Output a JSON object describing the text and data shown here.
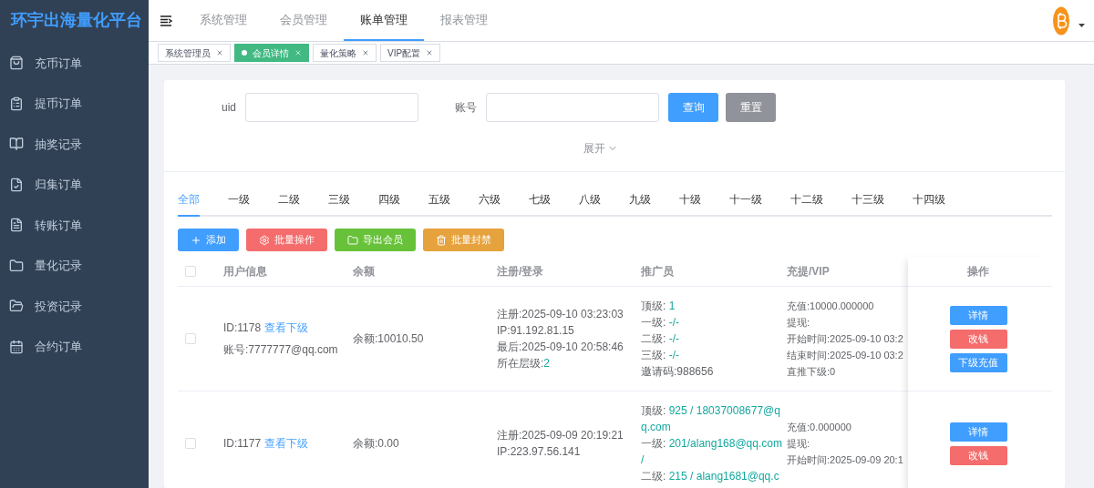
{
  "sidebar": {
    "title": "环宇出海量化平台",
    "items": [
      {
        "label": "充币订单",
        "kind": "bag"
      },
      {
        "label": "提币订单",
        "kind": "clipboard"
      },
      {
        "label": "抽奖记录",
        "kind": "book"
      },
      {
        "label": "归集订单",
        "kind": "doc-check"
      },
      {
        "label": "转账订单",
        "kind": "doc"
      },
      {
        "label": "量化记录",
        "kind": "folder"
      },
      {
        "label": "投资记录",
        "kind": "folder-open"
      },
      {
        "label": "合约订单",
        "kind": "calendar"
      }
    ]
  },
  "header": {
    "nav": [
      {
        "label": "系统管理",
        "selected": false
      },
      {
        "label": "会员管理",
        "selected": false
      },
      {
        "label": "账单管理",
        "selected": true
      },
      {
        "label": "报表管理",
        "selected": false
      }
    ]
  },
  "tags": [
    {
      "label": "系统管理员",
      "selected": false
    },
    {
      "label": "会员详情",
      "selected": true
    },
    {
      "label": "量化策略",
      "selected": false
    },
    {
      "label": "VIP配置",
      "selected": false
    }
  ],
  "search": {
    "fields": [
      {
        "label": "uid"
      },
      {
        "label": "账号"
      }
    ],
    "buttons": [
      {
        "label": "查询",
        "kind": "primary"
      },
      {
        "label": "重置",
        "kind": "secondary"
      }
    ],
    "expand": "展开"
  },
  "level_tabs": [
    {
      "label": "全部",
      "selected": true
    },
    {
      "label": "一级",
      "selected": false
    },
    {
      "label": "二级",
      "selected": false
    },
    {
      "label": "三级",
      "selected": false
    },
    {
      "label": "四级",
      "selected": false
    },
    {
      "label": "五级",
      "selected": false
    },
    {
      "label": "六级",
      "selected": false
    },
    {
      "label": "七级",
      "selected": false
    },
    {
      "label": "八级",
      "selected": false
    },
    {
      "label": "九级",
      "selected": false
    },
    {
      "label": "十级",
      "selected": false
    },
    {
      "label": "十一级",
      "selected": false
    },
    {
      "label": "十二级",
      "selected": false
    },
    {
      "label": "十三级",
      "selected": false
    },
    {
      "label": "十四级",
      "selected": false
    }
  ],
  "actions": [
    {
      "label": "添加",
      "kind": "add",
      "color": "#409eff"
    },
    {
      "label": "批量操作",
      "kind": "batch",
      "color": "#f56c6c"
    },
    {
      "label": "导出会员",
      "kind": "export",
      "color": "#67c23a"
    },
    {
      "label": "批量封禁",
      "kind": "ban",
      "color": "#e6a23c"
    }
  ],
  "table": {
    "select_all": {
      "checked": false
    },
    "columns": [
      "用户信息",
      "余额",
      "注册/登录",
      "推广员",
      "充提/VIP",
      "操作"
    ],
    "rows": [
      {
        "checked": false,
        "id": "ID:1178",
        "link": "查看下级",
        "account": "账号:7777777@qq.com",
        "balance": "余额:10010.50",
        "register": [
          {
            "text": "注册:2025-09-10 03:23:03"
          },
          {
            "text": "IP:91.192.81.15"
          },
          {
            "text": "最后:2025-09-10 20:58:46"
          },
          {
            "text": "所在层级:",
            "value": "2"
          }
        ],
        "promoter": [
          {
            "label": "顶级:",
            "value": "1"
          },
          {
            "label": "一级:",
            "value": "-/-"
          },
          {
            "label": "二级:",
            "value": "-/-"
          },
          {
            "label": "三级:",
            "value": "-/-"
          },
          {
            "label": "邀请码:988656"
          }
        ],
        "vip": [
          "充值:10000.000000",
          "提现:",
          "开始时间:2025-09-10 03:2",
          "结束时间:2025-09-10 03:2",
          "直推下级:0"
        ],
        "buttons": [
          {
            "label": "详情",
            "kind": "primary"
          },
          {
            "label": "改钱",
            "kind": "danger"
          },
          {
            "label": "下级充值",
            "kind": "primary"
          }
        ]
      },
      {
        "checked": false,
        "id": "ID:1177",
        "link": "查看下级",
        "balance": "余额:0.00",
        "register": [
          {
            "text": "注册:2025-09-09 20:19:21"
          },
          {
            "text": "IP:223.97.56.141"
          }
        ],
        "promoter": [
          {
            "label": "顶级:",
            "value": "925 / 18037008677@qq.com"
          },
          {
            "label": "一级:",
            "value": "201/alang168@qq.com /"
          },
          {
            "label": "二级:",
            "value": "215 / alang1681@qq.c"
          }
        ],
        "vip": [
          "充值:0.000000",
          "提现:",
          "开始时间:2025-09-09 20:1"
        ],
        "buttons": [
          {
            "label": "详情",
            "kind": "primary"
          },
          {
            "label": "改钱",
            "kind": "danger"
          }
        ]
      }
    ]
  }
}
